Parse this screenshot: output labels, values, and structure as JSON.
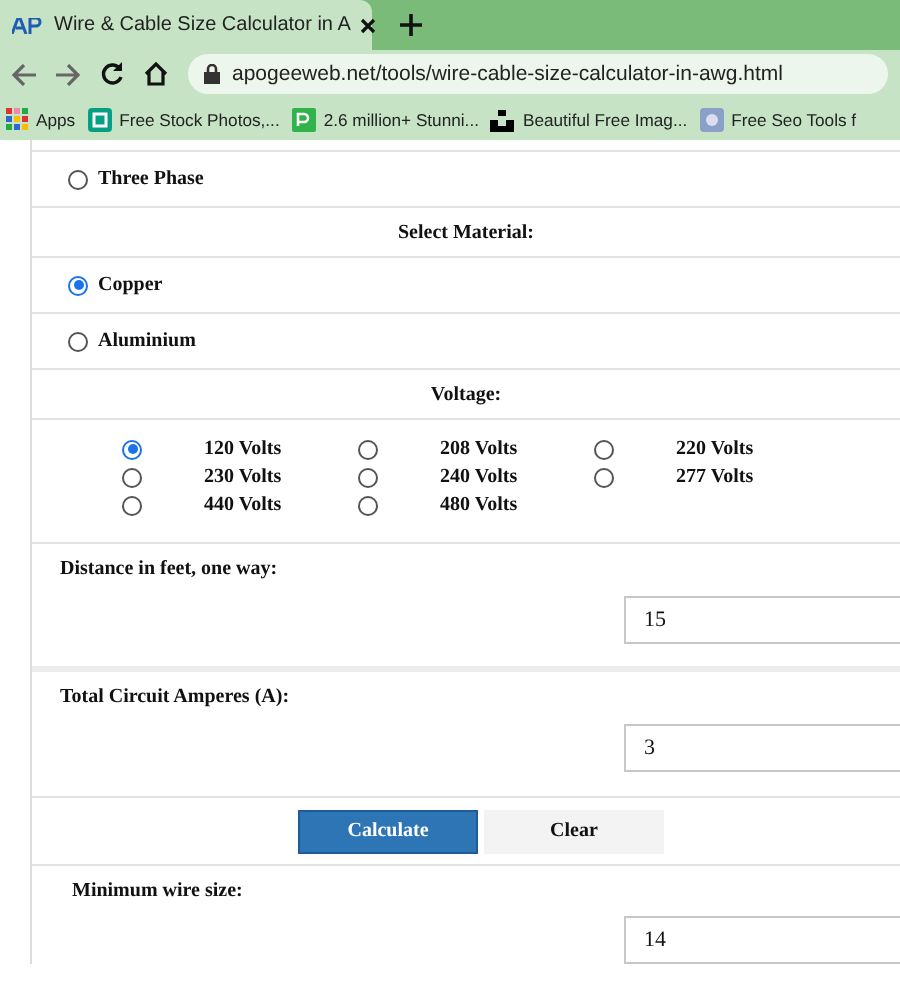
{
  "browser": {
    "tab_title": "Wire & Cable Size Calculator in A",
    "url": "apogeeweb.net/tools/wire-cable-size-calculator-in-awg.html",
    "bookmarks": [
      {
        "label": "Apps",
        "kind": "apps"
      },
      {
        "label": "Free Stock Photos,...",
        "kind": "stock"
      },
      {
        "label": "2.6 million+ Stunni...",
        "kind": "px"
      },
      {
        "label": "Beautiful Free Imag...",
        "kind": "unsplash"
      },
      {
        "label": "Free Seo Tools f",
        "kind": "seo"
      }
    ]
  },
  "phase_options": [
    {
      "label": "Three Phase",
      "selected": false
    }
  ],
  "material_heading": "Select Material:",
  "materials": [
    {
      "label": "Copper",
      "selected": true
    },
    {
      "label": "Aluminium",
      "selected": false
    }
  ],
  "voltage_heading": "Voltage:",
  "voltages": [
    {
      "label": "120 Volts",
      "selected": true
    },
    {
      "label": "208 Volts",
      "selected": false
    },
    {
      "label": "220 Volts",
      "selected": false
    },
    {
      "label": "230 Volts",
      "selected": false
    },
    {
      "label": "240 Volts",
      "selected": false
    },
    {
      "label": "277 Volts",
      "selected": false
    },
    {
      "label": "440 Volts",
      "selected": false
    },
    {
      "label": "480 Volts",
      "selected": false
    }
  ],
  "fields": [
    {
      "label": "Distance in feet, one way:",
      "value": "15"
    },
    {
      "label": "Total Circuit Amperes (A):",
      "value": "3"
    }
  ],
  "buttons": [
    {
      "label": "Calculate",
      "kind": "primary"
    },
    {
      "label": "Clear",
      "kind": "secondary"
    }
  ],
  "result": {
    "label": "Minimum wire size:",
    "value": "14"
  }
}
